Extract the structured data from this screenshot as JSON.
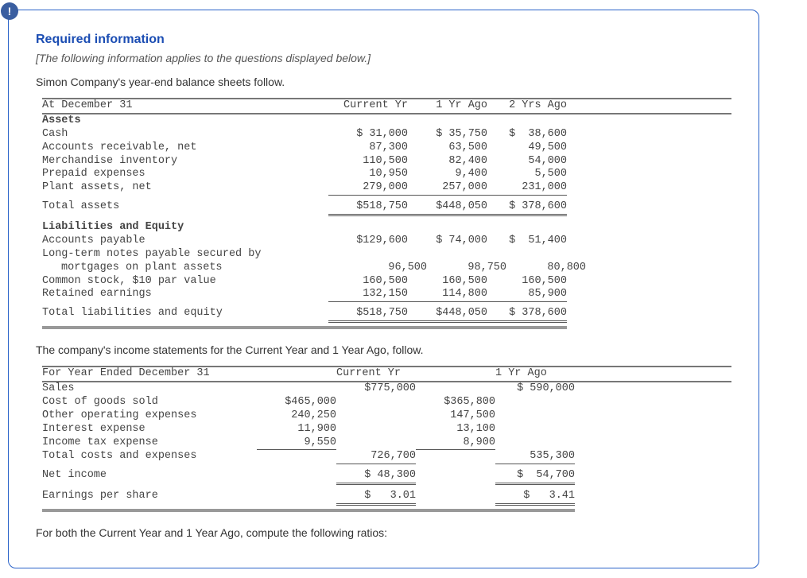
{
  "badge": "!",
  "heading": "Required information",
  "subhead_italic": "[The following information applies to the questions displayed below.]",
  "intro_line": "Simon Company's year-end balance sheets follow.",
  "bs": {
    "hdr": {
      "c0": "At December 31",
      "c1": "Current Yr",
      "c2": "1 Yr Ago",
      "c3": "2 Yrs Ago"
    },
    "assets_label": "Assets",
    "rows_assets": [
      {
        "c0": "Cash",
        "c1": "$ 31,000",
        "c2": "$ 35,750",
        "c3": "$  38,600"
      },
      {
        "c0": "Accounts receivable, net",
        "c1": "87,300",
        "c2": "63,500",
        "c3": "49,500"
      },
      {
        "c0": "Merchandise inventory",
        "c1": "110,500",
        "c2": "82,400",
        "c3": "54,000"
      },
      {
        "c0": "Prepaid expenses",
        "c1": "10,950",
        "c2": "9,400",
        "c3": "5,500"
      },
      {
        "c0": "Plant assets, net",
        "c1": "279,000",
        "c2": "257,000",
        "c3": "231,000"
      }
    ],
    "total_assets": {
      "c0": "Total assets",
      "c1": "$518,750",
      "c2": "$448,050",
      "c3": "$ 378,600"
    },
    "liab_label": "Liabilities and Equity",
    "rows_liab1": [
      {
        "c0": "Accounts payable",
        "c1": "$129,600",
        "c2": "$ 74,000",
        "c3": "$  51,400"
      }
    ],
    "longterm_l1": "Long-term notes payable secured by",
    "longterm_l2": "mortgages on plant assets",
    "longterm_vals": {
      "c1": "96,500",
      "c2": "98,750",
      "c3": "80,800"
    },
    "rows_liab2": [
      {
        "c0": "Common stock, $10 par value",
        "c1": "160,500",
        "c2": "160,500",
        "c3": "160,500"
      },
      {
        "c0": "Retained earnings",
        "c1": "132,150",
        "c2": "114,800",
        "c3": "85,900"
      }
    ],
    "total_liab": {
      "c0": "Total liabilities and equity",
      "c1": "$518,750",
      "c2": "$448,050",
      "c3": "$ 378,600"
    }
  },
  "is_intro": "The company's income statements for the Current Year and 1 Year Ago, follow.",
  "is": {
    "hdr": {
      "c0": "For Year Ended December 31",
      "c12": "Current Yr",
      "c34": "1 Yr Ago"
    },
    "sales": {
      "c0": "Sales",
      "c2": "$775,000",
      "c4": "$ 590,000"
    },
    "exp": [
      {
        "c0": "Cost of goods sold",
        "c1": "$465,000",
        "c3": "$365,800"
      },
      {
        "c0": "Other operating expenses",
        "c1": "240,250",
        "c3": "147,500"
      },
      {
        "c0": "Interest expense",
        "c1": "11,900",
        "c3": "13,100"
      },
      {
        "c0": "Income tax expense",
        "c1": "9,550",
        "c3": "8,900"
      }
    ],
    "total_costs": {
      "c0": "Total costs and expenses",
      "c2": "726,700",
      "c4": "535,300"
    },
    "net_income": {
      "c0": "Net income",
      "c2": "$ 48,300",
      "c4": "$  54,700"
    },
    "eps": {
      "c0": "Earnings per share",
      "c2": "$   3.01",
      "c4": "$   3.41"
    }
  },
  "closing_line": "For both the Current Year and 1 Year Ago, compute the following ratios:"
}
